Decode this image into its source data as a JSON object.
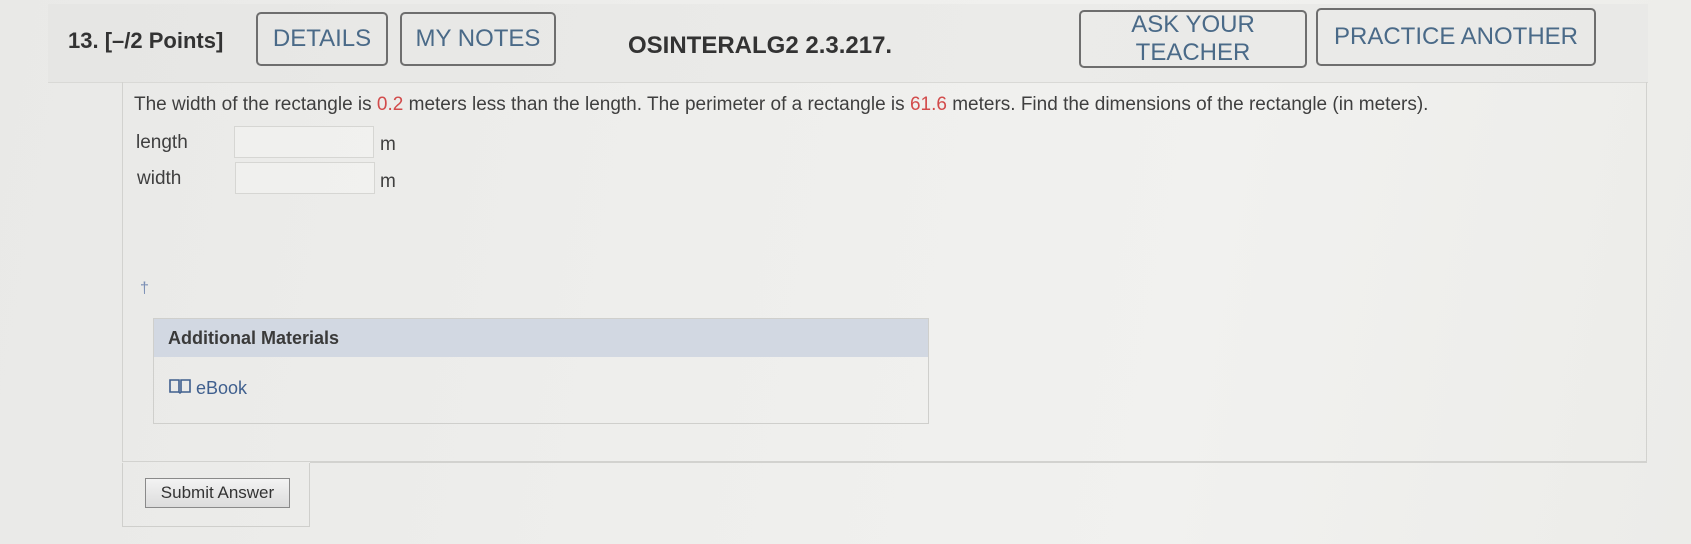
{
  "question": {
    "number": "13.",
    "points": "[–/2 Points]",
    "assignment_id": "OSINTERALG2 2.3.217."
  },
  "toolbar": {
    "details_label": "DETAILS",
    "my_notes_label": "MY NOTES",
    "ask_teacher_label": "ASK YOUR TEACHER",
    "practice_another_label": "PRACTICE ANOTHER"
  },
  "problem": {
    "part1": "The width of the rectangle is ",
    "value1": "0.2",
    "part2": " meters less than the length. The perimeter of a rectangle is ",
    "value2": "61.6",
    "part3": " meters. Find the dimensions of the rectangle (in meters).",
    "accent_color": "#d24b4b"
  },
  "answers": {
    "length_label": "length",
    "length_value": "",
    "length_unit": "m",
    "width_label": "width",
    "width_value": "",
    "width_unit": "m"
  },
  "footnote_symbol": "†",
  "materials": {
    "heading": "Additional Materials",
    "ebook_label": "eBook",
    "ebook_icon": "book-icon"
  },
  "submit_label": "Submit Answer"
}
